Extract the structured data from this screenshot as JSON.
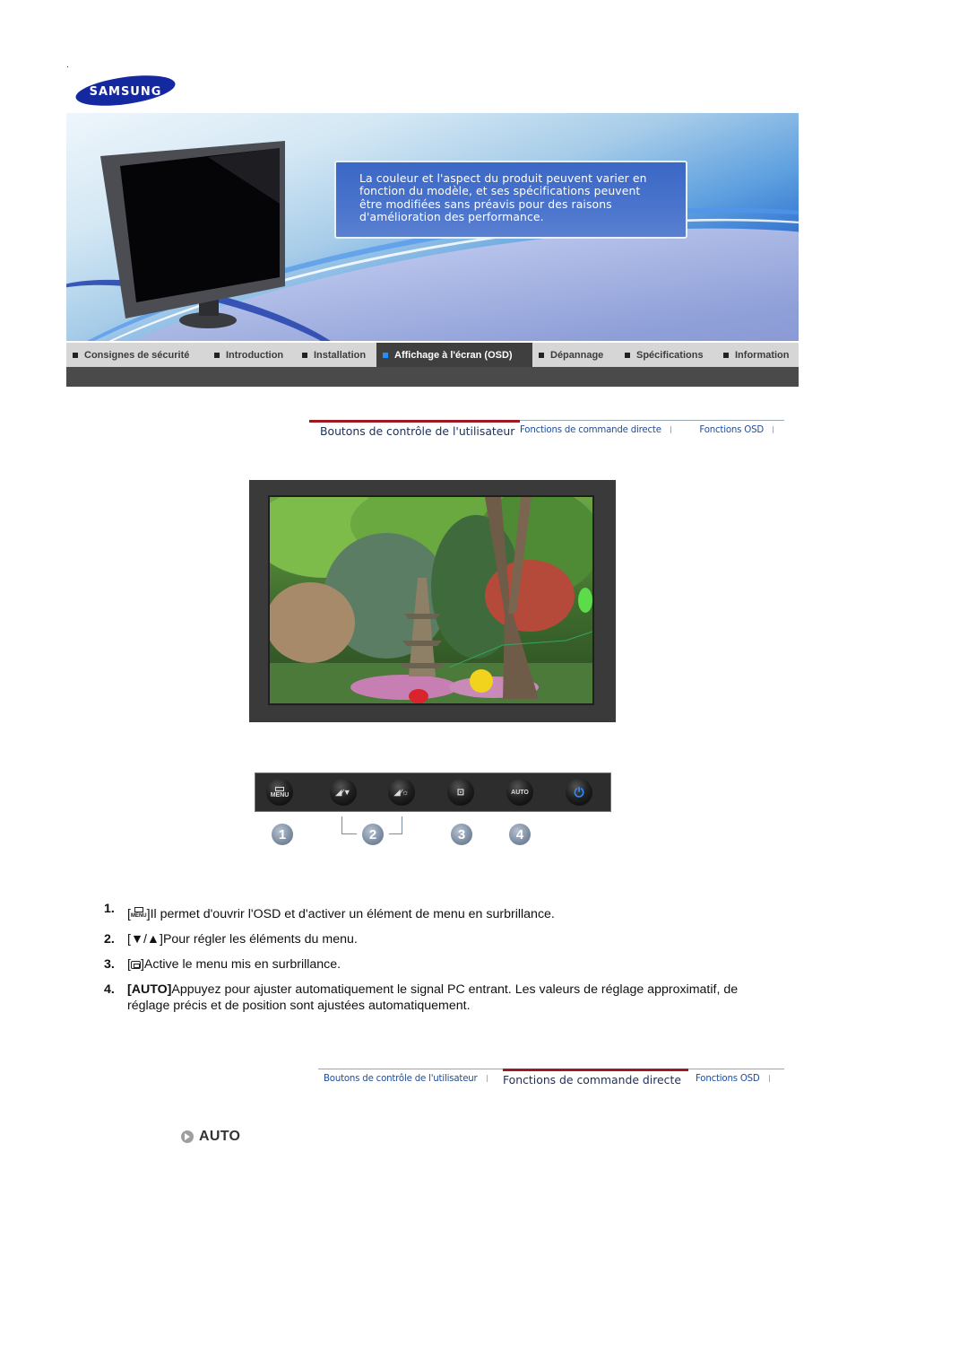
{
  "brand": {
    "logo_text": "SAMSUNG",
    "color": "#1428a0"
  },
  "banner": {
    "notice_lines": [
      "La couleur et l'aspect du produit peuvent varier en",
      "fonction du modèle, et ses spécifications peuvent",
      "être modifiées sans préavis pour des raisons",
      "d'amélioration des performance."
    ]
  },
  "nav": {
    "items": [
      {
        "label": "Consignes de sécurité",
        "active": false
      },
      {
        "label": "Introduction",
        "active": false
      },
      {
        "label": "Installation",
        "active": false
      },
      {
        "label": "Affichage à l'écran (OSD)",
        "active": true
      },
      {
        "label": "Dépannage",
        "active": false
      },
      {
        "label": "Spécifications",
        "active": false
      },
      {
        "label": "Information",
        "active": false
      }
    ],
    "active_color": "#1e90ff"
  },
  "subtabs_top": {
    "items": [
      {
        "label": "Boutons de contrôle de l'utilisateur",
        "active": true
      },
      {
        "label": "Fonctions de commande directe",
        "active": false
      },
      {
        "label": "Fonctions OSD",
        "active": false
      }
    ]
  },
  "control_panel": {
    "buttons": [
      {
        "icon": "menu-icon",
        "label": "MENU"
      },
      {
        "icon": "brightness-down-icon",
        "label": "▼"
      },
      {
        "icon": "brightness-up-icon",
        "label": "☼"
      },
      {
        "icon": "enter-icon",
        "label": "⊡"
      },
      {
        "icon": "auto-icon",
        "label": "AUTO"
      },
      {
        "icon": "power-icon",
        "label": "⏻"
      }
    ],
    "badges": [
      "1",
      "2",
      "3",
      "4"
    ]
  },
  "instructions": [
    {
      "num": "1.",
      "key": "MENU",
      "text": "]Il permet d'ouvrir l'OSD et d'activer un élément de menu en surbrillance."
    },
    {
      "num": "2.",
      "key": "▼/▲",
      "text": "Pour régler les éléments du menu."
    },
    {
      "num": "3.",
      "key": "",
      "text": "Active le menu mis en surbrillance."
    },
    {
      "num": "4.",
      "key": "AUTO",
      "text": "Appuyez pour ajuster automatiquement le signal PC entrant. Les valeurs de réglage approximatif, de réglage précis et de position sont ajustées automatiquement."
    }
  ],
  "subtabs_bottom": {
    "items": [
      {
        "label": "Boutons de contrôle de l'utilisateur",
        "active": false
      },
      {
        "label": "Fonctions de commande directe",
        "active": true
      },
      {
        "label": "Fonctions OSD",
        "active": false
      }
    ]
  },
  "section": {
    "title": "AUTO"
  }
}
